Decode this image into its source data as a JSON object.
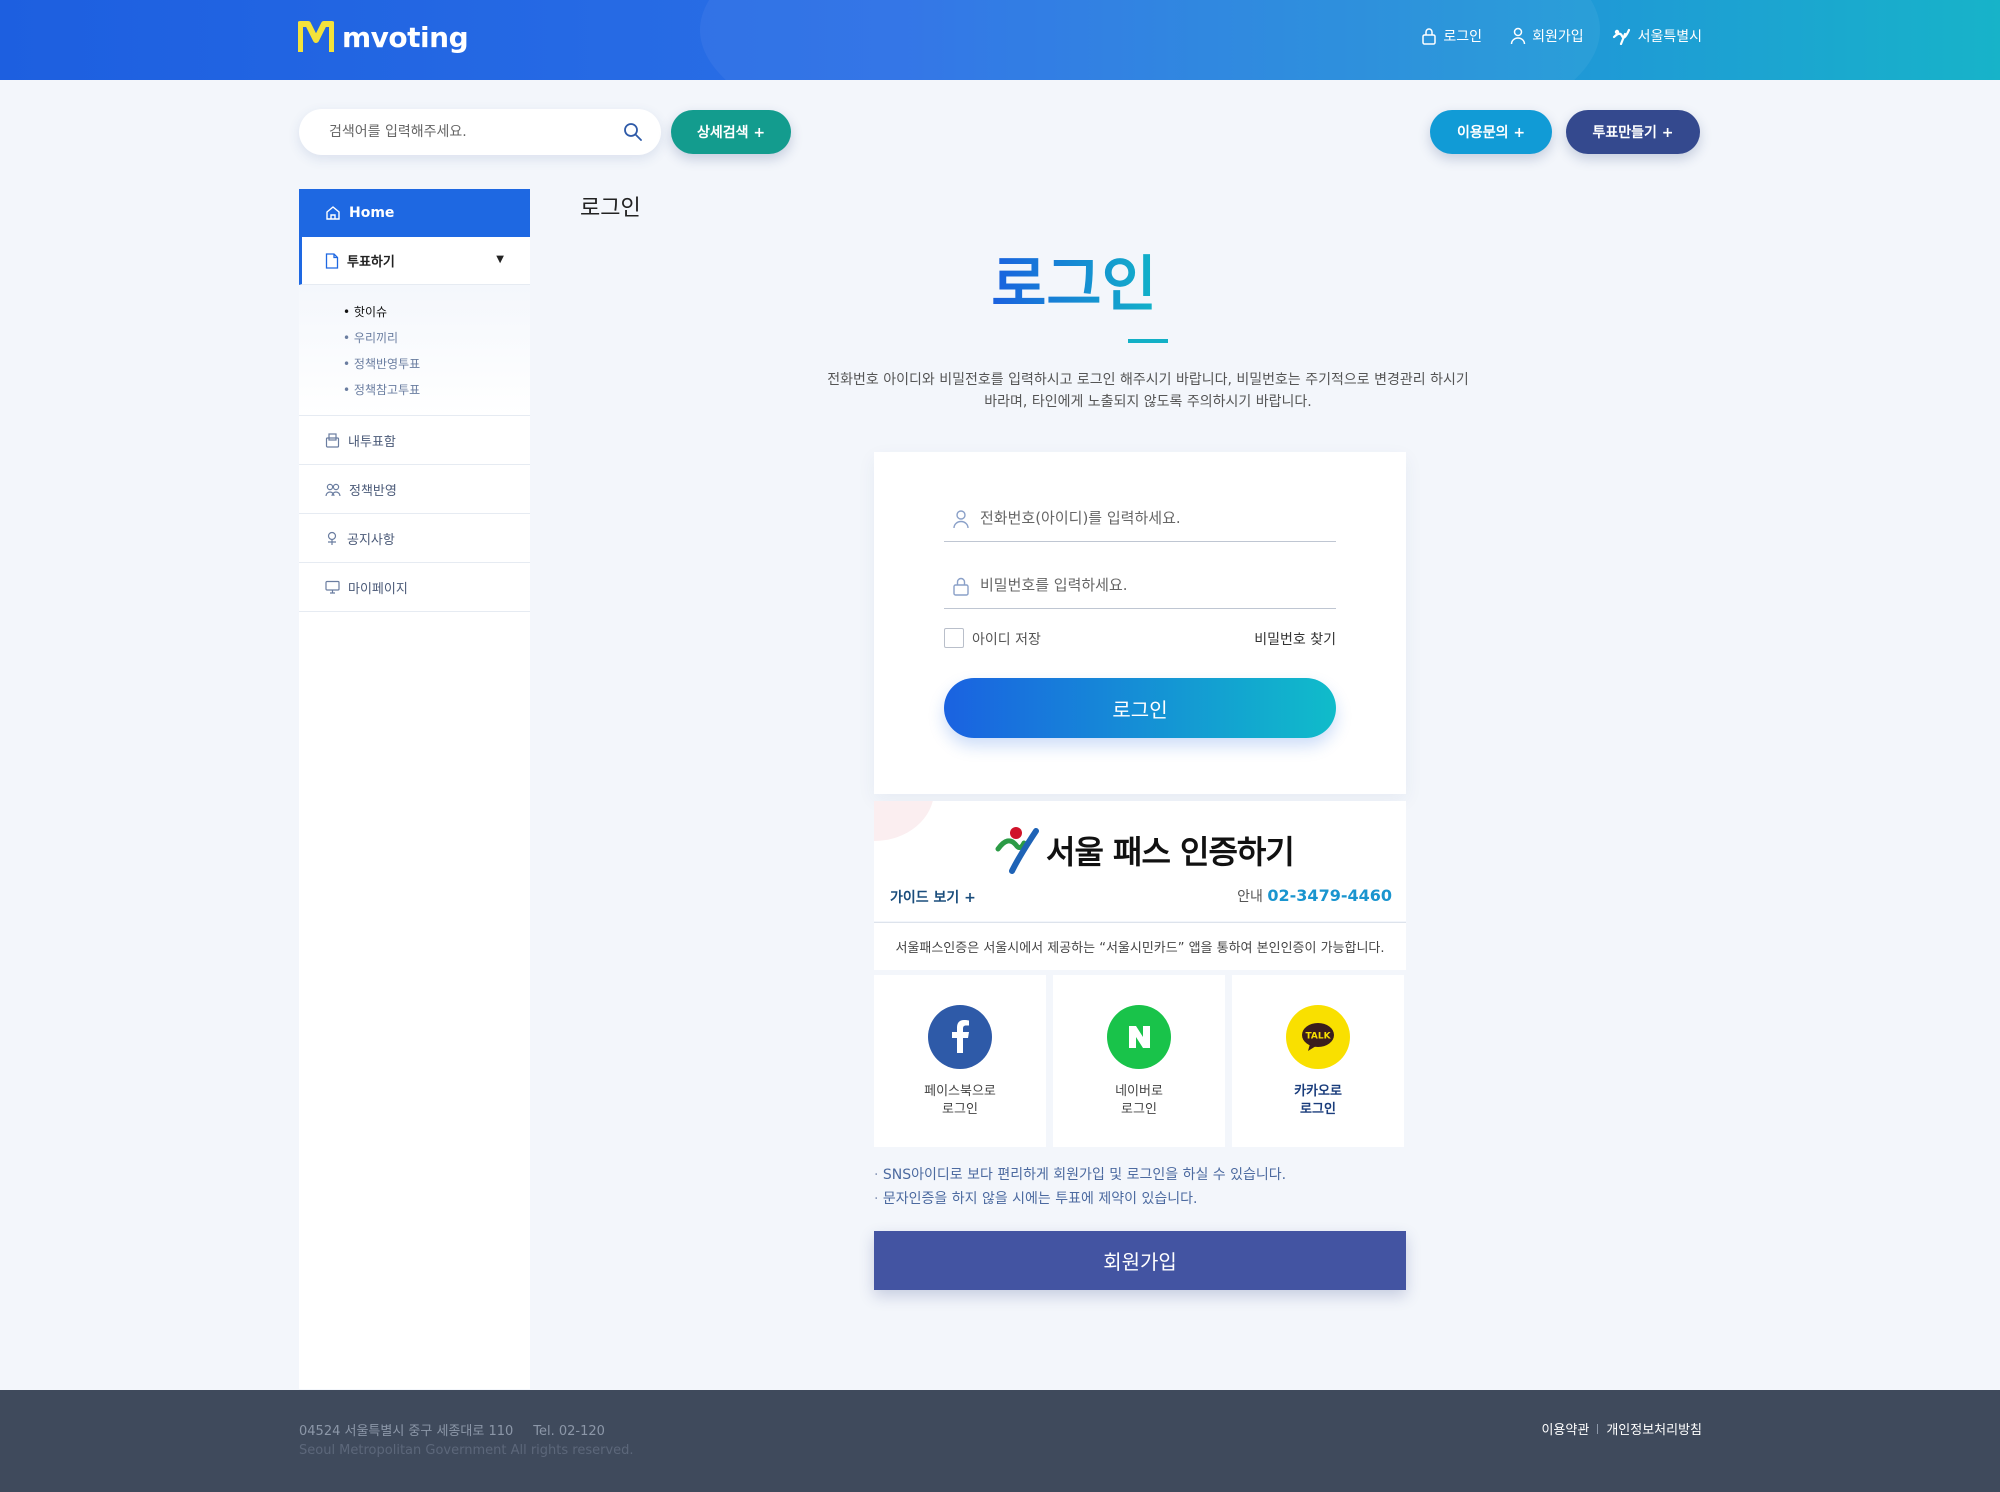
{
  "header": {
    "logo_text": "mvoting",
    "nav": [
      {
        "label": "로그인",
        "icon": "lock-icon"
      },
      {
        "label": "회원가입",
        "icon": "user-icon"
      },
      {
        "label": "서울특별시",
        "icon": "seoul-logo-icon"
      }
    ]
  },
  "search": {
    "placeholder": "검색어를 입력해주세요.",
    "detail_label": "상세검색 +"
  },
  "actions": {
    "inquiry_label": "이용문의 +",
    "make_vote_label": "투표만들기 +"
  },
  "sidebar": {
    "home": "Home",
    "vote": "투표하기",
    "vote_sub": [
      "핫이슈",
      "우리끼리",
      "정책반영투표",
      "정책참고투표"
    ],
    "items": [
      "내투표함",
      "정책반영",
      "공지사항",
      "마이페이지"
    ]
  },
  "page": {
    "title": "로그인",
    "big_title": "로그인",
    "desc_line1": "전화번호 아이디와 비밀전호를 입력하시고 로그인 해주시기 바랍니다, 비밀번호는 주기적으로 변경관리 하시기",
    "desc_line2": "바라며, 타인에게 노출되지 않도록 주의하시기 바랍니다."
  },
  "login_form": {
    "id_placeholder": "전화번호(아이디)를 입력하세요.",
    "pw_placeholder": "비밀번호를 입력하세요.",
    "save_id_label": "아이디 저장",
    "find_pw_label": "비밀번호 찾기",
    "login_button": "로그인"
  },
  "seoul_pass": {
    "title": "서울 패스 인증하기",
    "guide_label": "가이드 보기 +",
    "info_prefix": "안내",
    "phone": "02-3479-4460",
    "notice": "서울패스인증은 서울시에서 제공하는 “서울시민카드” 앱을 통하여 본인인증이 가능합니다."
  },
  "sns": [
    {
      "line1": "페이스북으로",
      "line2": "로그인",
      "color": "#2e5aa8"
    },
    {
      "line1": "네이버로",
      "line2": "로그인",
      "color": "#19c34a"
    },
    {
      "line1": "카카오로",
      "line2": "로그인",
      "color": "#f9e000"
    }
  ],
  "notes": [
    "SNS아이디로 보다 편리하게 회원가입 및 로그인을 하실 수 있습니다.",
    "문자인증을 하지 않을 시에는 투표에 제약이 있습니다."
  ],
  "join_button": "회원가입",
  "footer": {
    "address": "04524 서울특별시 중구 세종대로 110",
    "tel": "Tel. 02-120",
    "copyright": "Seoul Metropolitan Government All rights reserved.",
    "links": [
      "이용약관",
      "개인정보처리방침"
    ]
  },
  "colors": {
    "primary": "#1e68e2",
    "teal": "#139c8e",
    "navy": "#34498e",
    "join": "#4354a2",
    "footer": "#3f4a5c"
  }
}
